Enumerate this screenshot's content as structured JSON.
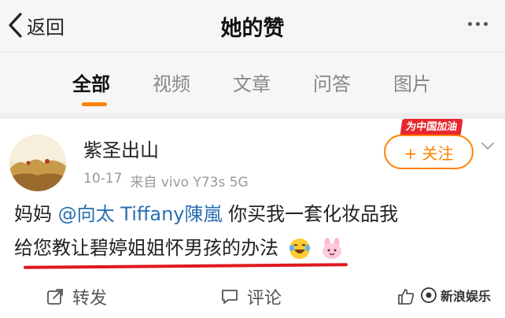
{
  "header": {
    "back_label": "返回",
    "title": "她的赞"
  },
  "tabs": [
    {
      "label": "全部",
      "active": true
    },
    {
      "label": "视频",
      "active": false
    },
    {
      "label": "文章",
      "active": false
    },
    {
      "label": "问答",
      "active": false
    },
    {
      "label": "图片",
      "active": false
    }
  ],
  "post": {
    "author": "紫圣出山",
    "date": "10-17",
    "source": "来自 vivo Y73s 5G",
    "badge": "为中国加油",
    "follow_label": "+ 关注",
    "text_start": "妈妈 ",
    "mention": "@向太 Tiffany陳嵐",
    "text_line1_rest": " 你买我一套化妆品我",
    "text_line2": "给您教让碧婷姐姐怀男孩的办法",
    "actions": {
      "repost": "转发",
      "comment": "评论"
    },
    "watermark": "新浪娱乐"
  },
  "colors": {
    "accent": "#ff8200",
    "link": "#2a6fb2",
    "underline_mark": "#e0181f",
    "badge_red": "#e8262e"
  }
}
